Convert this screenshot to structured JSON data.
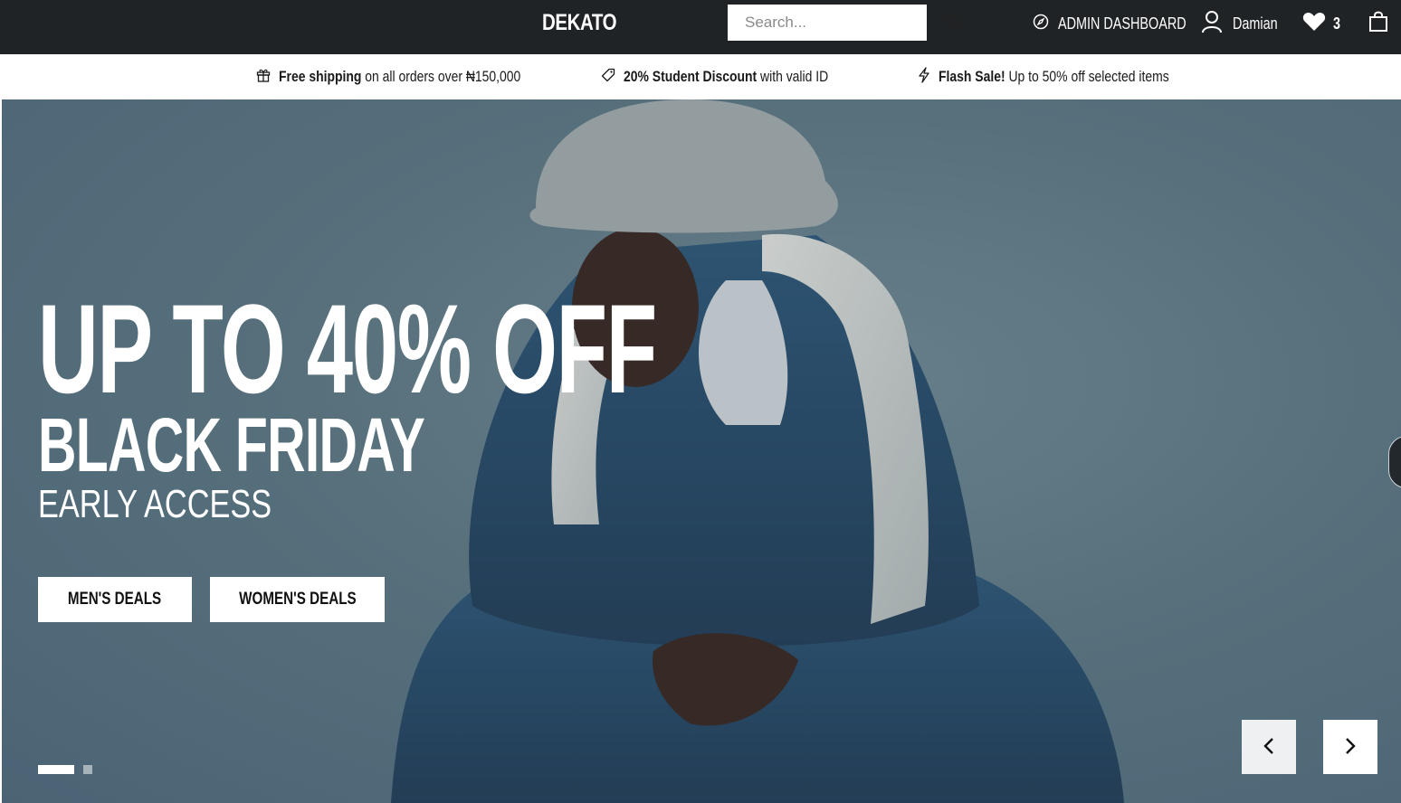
{
  "header": {
    "logo": "DEKATO",
    "search_placeholder": "Search...",
    "admin_label": "ADMIN DASHBOARD",
    "user_name": "Damian",
    "wishlist_count": "3",
    "icons": [
      "search-icon",
      "compass-icon",
      "user-icon",
      "heart-icon",
      "shopping-bag-icon"
    ]
  },
  "promos": [
    {
      "icon": "gift-icon",
      "bold": "Free shipping",
      "text": " on all orders over ₦150,000"
    },
    {
      "icon": "tag-icon",
      "bold": "20% Student Discount",
      "text": " with valid ID"
    },
    {
      "icon": "lightning-icon",
      "bold": "Flash Sale!",
      "text": " Up to 50% off selected items"
    }
  ],
  "hero": {
    "headline": "UP TO 40% OFF",
    "subheadline": "BLACK FRIDAY",
    "tagline": "EARLY ACCESS",
    "buttons": {
      "men": "MEN'S DEALS",
      "women": "WOMEN'S DEALS"
    },
    "slides_total": 2,
    "active_slide": 1,
    "colors": {
      "nav_bg": "#1f2326",
      "hero_bg": "#5d7783",
      "text": "#ffffff"
    }
  }
}
